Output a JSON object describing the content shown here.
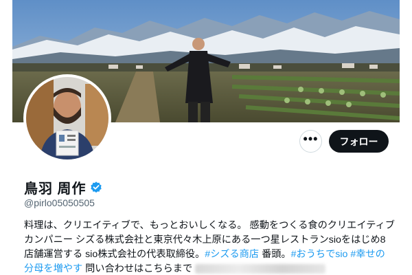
{
  "profile": {
    "display_name": "鳥羽 周作",
    "handle": "@pirlo05050505",
    "verified": true,
    "verified_color": "#1d9bf0"
  },
  "actions": {
    "more_label": "•••",
    "follow_label": "フォロー"
  },
  "bio": {
    "seg1": "料理は、クリエイティブで、もっとおいしくなる。 感動をつくる食のクリエイティブカンパニー シズる株式会社と東京代々木上原にある一つ星レストランsioをはじめ8店舗運営する sio株式会社の代表取締役。",
    "hashtag1": "#シズる商店",
    "seg2": " 番頭。",
    "hashtag2": "#おうちでsio",
    "seg3": " ",
    "hashtag3": "#幸せの分母を増やす",
    "seg4": " 問い合わせはこちらまで"
  },
  "colors": {
    "link": "#1d9bf0",
    "follow_bg": "#0f1419",
    "handle_text": "#536471"
  },
  "icons": [
    "more-icon",
    "verified-badge-icon"
  ]
}
